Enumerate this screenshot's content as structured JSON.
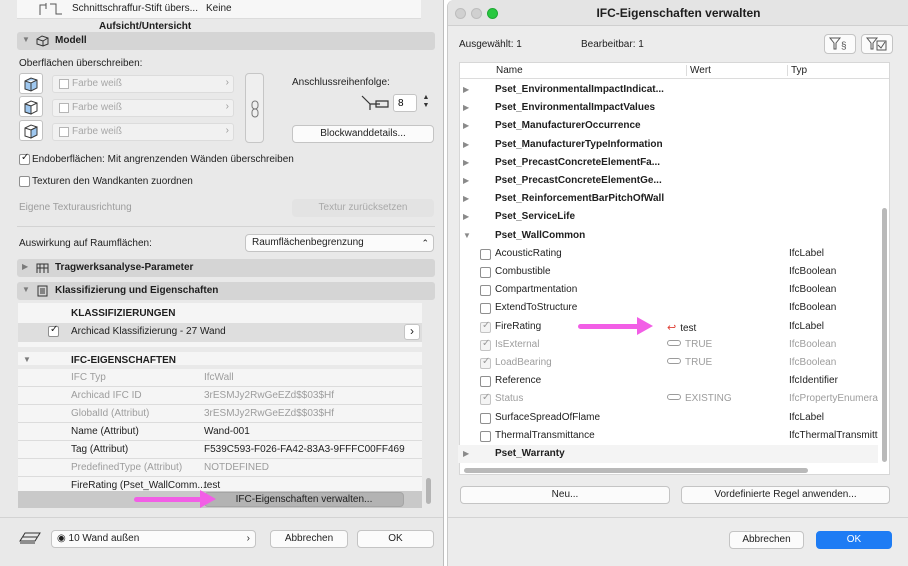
{
  "left": {
    "top_rows": {
      "pen_label": "Schnittschraffur-Stift übers...",
      "pen_value": "Keine",
      "cut_label": "Aufsicht/Untersicht"
    },
    "modell": {
      "title": "Modell",
      "overrides_label": "Oberflächen überschreiben:",
      "surface_rows": [
        "Farbe weiß",
        "Farbe weiß",
        "Farbe weiß"
      ],
      "connection_label": "Anschlussreihenfolge:",
      "connection_value": "8",
      "composite_button": "Blockwanddetails...",
      "end_surfaces_check": "Endoberflächen: Mit angrenzenden Wänden überschreiben",
      "end_surfaces_checked": true,
      "textures_check": "Texturen den Wandkanten zuordnen",
      "textures_checked": false,
      "texture_alignment_label": "Eigene Texturausrichtung",
      "texture_reset_button": "Textur zurücksetzen",
      "zone_effect_label": "Auswirkung auf Raumflächen:",
      "zone_effect_value": "Raumflächenbegrenzung"
    },
    "structural": {
      "title": "Tragwerksanalyse-Parameter"
    },
    "classification": {
      "title": "Klassifizierung und Eigenschaften",
      "classifications_header": "KLASSIFIZIERUNGEN",
      "classification_item": "Archicad Klassifizierung - 27 Wand",
      "ifc_header": "IFC-EIGENSCHAFTEN",
      "ifc_rows": [
        {
          "key": "IFC Typ",
          "value": "IfcWall",
          "disabled": true
        },
        {
          "key": "Archicad IFC ID",
          "value": "3rESMJy2RwGeEZd$$03$Hf",
          "disabled": true
        },
        {
          "key": "GlobalId (Attribut)",
          "value": "3rESMJy2RwGeEZd$$03$Hf",
          "disabled": true
        },
        {
          "key": "Name (Attribut)",
          "value": "Wand-001",
          "disabled": false
        },
        {
          "key": "Tag (Attribut)",
          "value": "F539C593-F026-FA42-83A3-9FFFC00FF469",
          "disabled": false
        },
        {
          "key": "PredefinedType (Attribut)",
          "value": "NOTDEFINED",
          "disabled": true
        },
        {
          "key": "FireRating (Pset_WallComm...",
          "value": "test",
          "disabled": false
        }
      ],
      "manage_button": "IFC-Eigenschaften verwalten..."
    },
    "footer": {
      "layer_value": "10 Wand außen",
      "cancel": "Abbrechen",
      "ok": "OK"
    }
  },
  "dialog": {
    "title": "IFC-Eigenschaften verwalten",
    "selected": "Ausgewählt: 1",
    "editable": "Bearbeitbar: 1",
    "columns": {
      "name": "Name",
      "value": "Wert",
      "type": "Typ"
    },
    "psets_before": [
      "Pset_EnvironmentalImpactIndicat...",
      "Pset_EnvironmentalImpactValues",
      "Pset_ManufacturerOccurrence",
      "Pset_ManufacturerTypeInformation",
      "Pset_PrecastConcreteElementFa...",
      "Pset_PrecastConcreteElementGe...",
      "Pset_ReinforcementBarPitchOfWall",
      "Pset_ServiceLife"
    ],
    "expanded_pset": "Pset_WallCommon",
    "properties": [
      {
        "name": "AcousticRating",
        "value": "",
        "type": "IfcLabel",
        "checked": false,
        "disabled": false,
        "value_icon": ""
      },
      {
        "name": "Combustible",
        "value": "",
        "type": "IfcBoolean",
        "checked": false,
        "disabled": false,
        "value_icon": ""
      },
      {
        "name": "Compartmentation",
        "value": "",
        "type": "IfcBoolean",
        "checked": false,
        "disabled": false,
        "value_icon": ""
      },
      {
        "name": "ExtendToStructure",
        "value": "",
        "type": "IfcBoolean",
        "checked": false,
        "disabled": false,
        "value_icon": ""
      },
      {
        "name": "FireRating",
        "value": "test",
        "type": "IfcLabel",
        "checked": true,
        "disabled": true,
        "value_icon": "undo-arrow-icon"
      },
      {
        "name": "IsExternal",
        "value": "TRUE",
        "type": "IfcBoolean",
        "checked": true,
        "disabled": true,
        "value_icon": "link-icon"
      },
      {
        "name": "LoadBearing",
        "value": "TRUE",
        "type": "IfcBoolean",
        "checked": true,
        "disabled": true,
        "value_icon": "link-icon"
      },
      {
        "name": "Reference",
        "value": "",
        "type": "IfcIdentifier",
        "checked": false,
        "disabled": false,
        "value_icon": ""
      },
      {
        "name": "Status",
        "value": "EXISTING",
        "type": "IfcPropertyEnumera",
        "checked": true,
        "disabled": true,
        "value_icon": "link-icon"
      },
      {
        "name": "SurfaceSpreadOfFlame",
        "value": "",
        "type": "IfcLabel",
        "checked": false,
        "disabled": false,
        "value_icon": ""
      },
      {
        "name": "ThermalTransmittance",
        "value": "",
        "type": "IfcThermalTransmitt",
        "checked": false,
        "disabled": false,
        "value_icon": ""
      }
    ],
    "psets_after": [
      "Pset_Warranty"
    ],
    "new_button": "Neu...",
    "apply_rule_button": "Vordefinierte Regel anwenden...",
    "cancel": "Abbrechen",
    "ok": "OK"
  },
  "colors": {
    "accent": "#1e7cf4",
    "annotation_arrow": "#f25ee6",
    "undo_icon": "#e0443a",
    "traffic_light_green": "#28c840"
  }
}
